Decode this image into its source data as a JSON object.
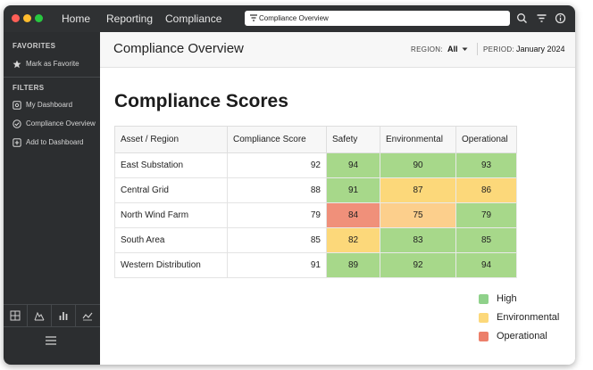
{
  "topbar": {
    "menu": [
      "Home",
      "Reporting",
      "Compliance"
    ],
    "search_value": "Compliance Overview",
    "icons": [
      "filter-icon",
      "search-icon",
      "filter-icon",
      "info-icon"
    ]
  },
  "sidebar": {
    "favorites_label": "FAVORITES",
    "favorites": [
      {
        "label": "Mark as Favorite",
        "icon": "star-icon"
      }
    ],
    "filters_label": "FILTERS",
    "filters": [
      {
        "label": "My Dashboard",
        "icon": "dashboard-icon"
      },
      {
        "label": "Compliance Overview",
        "icon": "check-icon"
      },
      {
        "label": "Add to Dashboard",
        "icon": "plus-icon"
      }
    ],
    "bottom_icons": [
      "grid-icon",
      "area-chart-icon",
      "bar-chart-icon",
      "line-chart-icon"
    ],
    "menu_icon": "hamburger-icon"
  },
  "header": {
    "title": "Compliance Overview",
    "region_label": "REGION:",
    "region_value": "All",
    "period_label": "PERIOD:",
    "period_value": "January 2024"
  },
  "section_title": "Compliance Scores",
  "table": {
    "columns": [
      "Asset / Region",
      "Compliance Score",
      "Safety",
      "Environmental",
      "Operational"
    ],
    "rows": [
      {
        "asset": "East Substation",
        "score": "92",
        "safety": "94",
        "environmental": "90",
        "operational": "93"
      },
      {
        "asset": "Central Grid",
        "score": "88",
        "safety": "91",
        "environmental": "87",
        "operational": "86"
      },
      {
        "asset": "North Wind Farm",
        "score": "79",
        "safety": "84",
        "environmental": "75",
        "operational": "79"
      },
      {
        "asset": "South Area",
        "score": "85",
        "safety": "82",
        "environmental": "83",
        "operational": "85"
      },
      {
        "asset": "Western Distribution",
        "score": "91",
        "safety": "89",
        "environmental": "92",
        "operational": "94"
      }
    ],
    "cell_colors": [
      [
        "#a7d88a",
        "#a7d88a",
        "#a7d88a"
      ],
      [
        "#a7d88a",
        "#fcd87a",
        "#fcd87a"
      ],
      [
        "#f0907a",
        "#fccf8c",
        "#a7d88a"
      ],
      [
        "#fcd87a",
        "#a7d88a",
        "#a7d88a"
      ],
      [
        "#a7d88a",
        "#a7d88a",
        "#a7d88a"
      ]
    ]
  },
  "legend": [
    {
      "label": "High",
      "color": "#8fd18a"
    },
    {
      "label": "Environmental",
      "color": "#fcd87a"
    },
    {
      "label": "Operational",
      "color": "#ec7f6a"
    }
  ]
}
